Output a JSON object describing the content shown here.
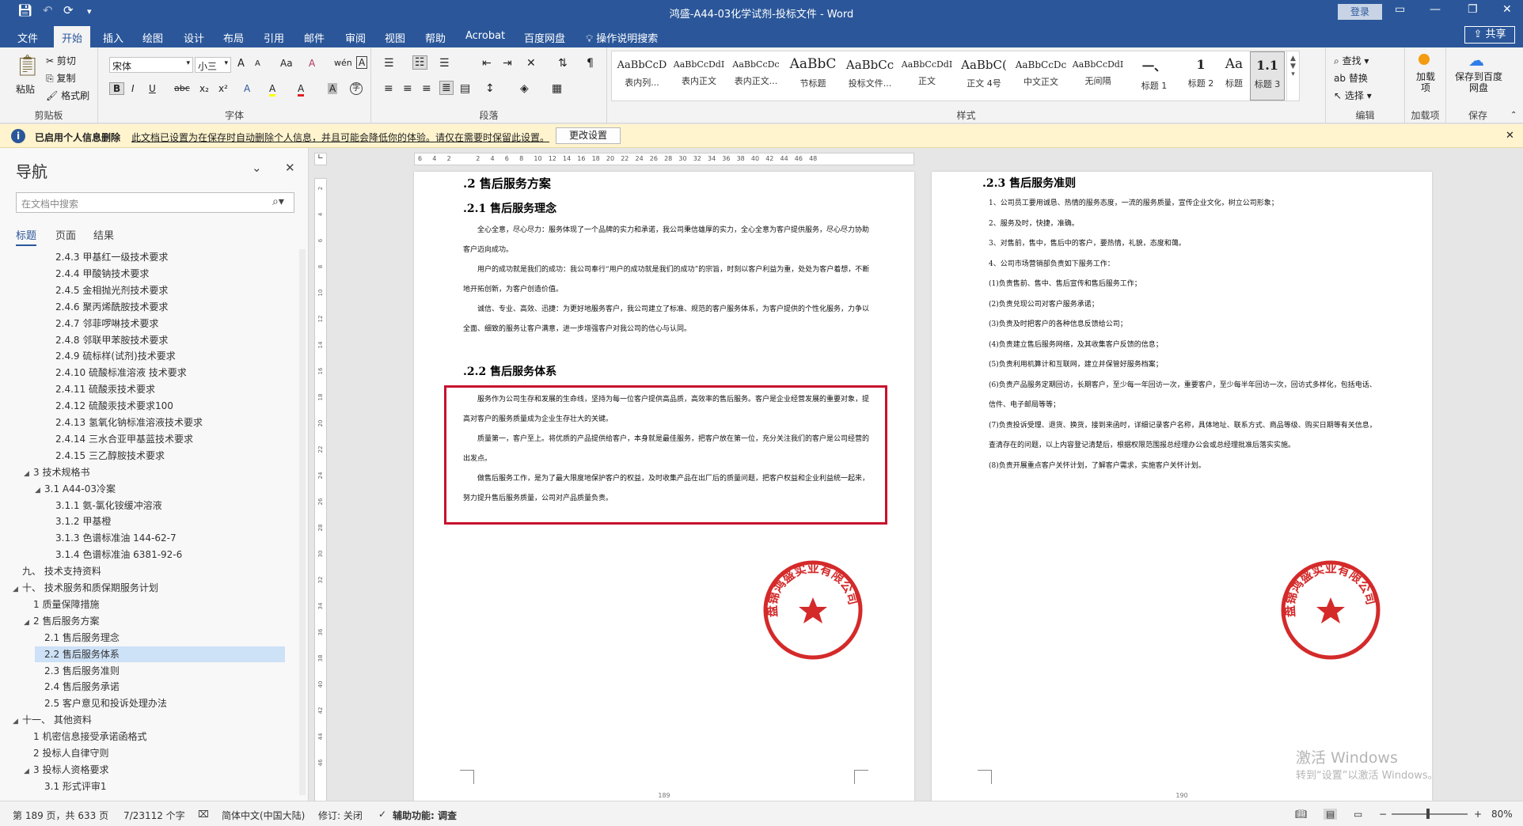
{
  "titlebar": {
    "doc_title": "鸿盛-A44-03化学试剂-投标文件 - Word",
    "login": "登录",
    "save_icon": "save-icon",
    "undo_icon": "undo-icon",
    "redo_icon": "redo-icon",
    "customize_icon": "customize-icon"
  },
  "menu": {
    "tabs": [
      "文件",
      "开始",
      "插入",
      "绘图",
      "设计",
      "布局",
      "引用",
      "邮件",
      "审阅",
      "视图",
      "帮助",
      "Acrobat",
      "百度网盘"
    ],
    "active": "开始",
    "tell_me": "操作说明搜索",
    "share": "共享"
  },
  "ribbon": {
    "clipboard": {
      "paste": "粘贴",
      "cut": "剪切",
      "copy": "复制",
      "format_painter": "格式刷",
      "label": "剪贴板"
    },
    "font": {
      "family": "宋体",
      "size": "小三",
      "label": "字体",
      "bold": "B",
      "italic": "I",
      "underline": "U",
      "strike": "abc",
      "subscript": "x₂",
      "superscript": "x²",
      "grow": "A",
      "shrink": "A",
      "case": "Aa",
      "clear": "A",
      "phonetic": "wén",
      "border_char": "A",
      "highlight": "A",
      "font_color": "A",
      "shading": "A",
      "enclose": "字"
    },
    "paragraph": {
      "label": "段落"
    },
    "styles": {
      "label": "样式",
      "items": [
        {
          "sample": "AaBbCcD",
          "name": "表内列..."
        },
        {
          "sample": "AaBbCcDdI",
          "name": "表内正文"
        },
        {
          "sample": "AaBbCcDc",
          "name": "表内正文..."
        },
        {
          "sample": "AaBbC",
          "name": "节标题"
        },
        {
          "sample": "AaBbCc",
          "name": "投标文件..."
        },
        {
          "sample": "AaBbCcDdI",
          "name": "正文"
        },
        {
          "sample": "AaBbC(",
          "name": "正文 4号"
        },
        {
          "sample": "AaBbCcDc",
          "name": "中文正文"
        },
        {
          "sample": "AaBbCcDdI",
          "name": "无间隔"
        },
        {
          "sample": "一、",
          "name": "标题 1"
        },
        {
          "sample": "1",
          "name": "标题 2"
        },
        {
          "sample": "Aa",
          "name": "标题"
        },
        {
          "sample": "1.1",
          "name": "标题 3"
        }
      ]
    },
    "editing": {
      "find": "查找",
      "replace": "替换",
      "select": "选择",
      "label": "编辑"
    },
    "addins": {
      "add": "加载项",
      "label": "加载项"
    },
    "save": {
      "save_to_baidu": "保存到百度网盘",
      "label": "保存"
    }
  },
  "infobar": {
    "title": "已启用个人信息删除",
    "message": "此文档已设置为在保存时自动删除个人信息，并且可能会降低你的体验。请仅在需要时保留此设置。",
    "button": "更改设置"
  },
  "nav": {
    "title": "导航",
    "search_placeholder": "在文档中搜索",
    "tabs": [
      "标题",
      "页面",
      "结果"
    ],
    "active_tab": "标题",
    "items": [
      {
        "label": "2.4.3 甲基红一级技术要求",
        "level": 4,
        "toggle": ""
      },
      {
        "label": "2.4.4 甲酸钠技术要求",
        "level": 4,
        "toggle": ""
      },
      {
        "label": "2.4.5 金相抛光剂技术要求",
        "level": 4,
        "toggle": ""
      },
      {
        "label": "2.4.6 聚丙烯酰胺技术要求",
        "level": 4,
        "toggle": ""
      },
      {
        "label": "2.4.7 邻菲啰啉技术要求",
        "level": 4,
        "toggle": ""
      },
      {
        "label": "2.4.8 邻联甲苯胺技术要求",
        "level": 4,
        "toggle": ""
      },
      {
        "label": "2.4.9 硫标样(试剂)技术要求",
        "level": 4,
        "toggle": ""
      },
      {
        "label": "2.4.10 硫酸标准溶液 技术要求",
        "level": 4,
        "toggle": ""
      },
      {
        "label": "2.4.11 硫酸汞技术要求",
        "level": 4,
        "toggle": ""
      },
      {
        "label": "2.4.12 硫酸汞技术要求100",
        "level": 4,
        "toggle": ""
      },
      {
        "label": "2.4.13 氢氧化钠标准溶液技术要求",
        "level": 4,
        "toggle": ""
      },
      {
        "label": "2.4.14 三水合亚甲基蓝技术要求",
        "level": 4,
        "toggle": ""
      },
      {
        "label": "2.4.15 三乙醇胺技术要求",
        "level": 4,
        "toggle": ""
      },
      {
        "label": "3 技术规格书",
        "level": 2,
        "toggle": "◢"
      },
      {
        "label": "3.1 A44-03冷案",
        "level": 3,
        "toggle": "◢"
      },
      {
        "label": "3.1.1 氨-氯化铵缓冲溶液",
        "level": 4,
        "toggle": ""
      },
      {
        "label": "3.1.2 甲基橙",
        "level": 4,
        "toggle": ""
      },
      {
        "label": "3.1.3 色谱标准油 144-62-7",
        "level": 4,
        "toggle": ""
      },
      {
        "label": "3.1.4 色谱标准油 6381-92-6",
        "level": 4,
        "toggle": ""
      },
      {
        "label": "九、 技术支持资料",
        "level": 1,
        "toggle": ""
      },
      {
        "label": "十、 技术服务和质保期服务计划",
        "level": 1,
        "toggle": "◢"
      },
      {
        "label": "1 质量保障措施",
        "level": 2,
        "toggle": ""
      },
      {
        "label": "2 售后服务方案",
        "level": 2,
        "toggle": "◢"
      },
      {
        "label": "2.1 售后服务理念",
        "level": 3,
        "toggle": ""
      },
      {
        "label": "2.2 售后服务体系",
        "level": 3,
        "toggle": "",
        "selected": true
      },
      {
        "label": "2.3 售后服务准则",
        "level": 3,
        "toggle": ""
      },
      {
        "label": "2.4 售后服务承诺",
        "level": 3,
        "toggle": ""
      },
      {
        "label": "2.5 客户意见和投诉处理办法",
        "level": 3,
        "toggle": ""
      },
      {
        "label": "十一、 其他资料",
        "level": 1,
        "toggle": "◢"
      },
      {
        "label": "1 机密信息接受承诺函格式",
        "level": 2,
        "toggle": ""
      },
      {
        "label": "2 投标人自律守则",
        "level": 2,
        "toggle": ""
      },
      {
        "label": "3 投标人资格要求",
        "level": 2,
        "toggle": "◢"
      },
      {
        "label": "3.1 形式评审1",
        "level": 3,
        "toggle": ""
      }
    ]
  },
  "ruler": {
    "h_ticks": [
      "6",
      "4",
      "2",
      "",
      "2",
      "4",
      "6",
      "8",
      "10",
      "12",
      "14",
      "16",
      "18",
      "20",
      "22",
      "24",
      "26",
      "28",
      "30",
      "32",
      "34",
      "36",
      "38",
      "40",
      "42",
      "44",
      "46",
      "48"
    ],
    "v_ticks": [
      "2",
      "4",
      "6",
      "8",
      "10",
      "12",
      "14",
      "16",
      "18",
      "20",
      "22",
      "24",
      "26",
      "28",
      "30",
      "32",
      "34",
      "36",
      "38",
      "40",
      "42",
      "44",
      "46"
    ]
  },
  "page1": {
    "h_2": ".2  售后服务方案",
    "h_21": ".2.1   售后服务理念",
    "p1": [
      "全心全意，尽心尽力：服务体现了一个品牌的实力和承诺，我公司秉信雄厚的实力，全心全意为客户提供服务，尽心尽力协助客户迈向成功。",
      "用户的成功就是我们的成功：我公司奉行“用户的成功就是我们的成功”的宗旨，时刻以客户利益为重，处处为客户着想，不断地开拓创新，为客户创造价值。",
      "诚信、专业、高效、迅捷：为更好地服务客户，我公司建立了标准、规范的客户服务体系，为客户提供的个性化服务，力争以全面、细致的服务让客户满意，进一步增强客户对我公司的信心与认同。"
    ],
    "h_22": ".2.2   售后服务体系",
    "p2": [
      "服务作为公司生存和发展的生命线，坚持为每一位客户提供高品质，高效率的售后服务。客户是企业经营发展的重要对象，提高对客户的服务质量成为企业生存壮大的关键。",
      "质量第一，客户至上。将优质的产品提供给客户，本身就是最佳服务，把客户放在第一位，充分关注我们的客户是公司经营的出发点。",
      "做售后服务工作，是为了最大限度地保护客户的权益，及时收集产品在出厂后的质量问题，把客户权益和企业利益统一起来，努力提升售后服务质量，公司对产品质量负责。"
    ],
    "page_number": "189"
  },
  "page2": {
    "h_23": ".2.3   售后服务准则",
    "items": [
      "1、公司员工要用诚恳、热情的服务态度，一流的服务质量，宣传企业文化，树立公司形象；",
      "2、服务及时，快捷，准确。",
      "3、对售前，售中，售后中的客户，要热情，礼貌，态度和蔼。",
      "4、公司市场营销部负责如下服务工作：",
      "(1)负责售前、售中、售后宣传和售后服务工作；",
      "(2)负责兑现公司对客户服务承诺；",
      "(3)负责及时把客户的各种信息反馈给公司；",
      "(4)负责建立售后服务网络，及其收集客户反馈的信息；",
      "(5)负责利用机算计和互联网，建立并保管好服务档案；",
      "(6)负责产品服务定期回访，长期客户，至少每一年回访一次，重要客户，至少每半年回访一次，回访式多样化，包括电话、信件、电子邮局等等；",
      "(7)负责投诉受理、退货、换货，接到来函时，详细记录客户名称，具体地址、联系方式、商品等级、购买日期等有关信息，查清存在的问题，以上内容登记清楚后，根据权限范围报总经理办公会或总经理批准后落实实施。",
      "(8)负责开展重点客户关怀计划，了解客户需求，实施客户关怀计划。"
    ],
    "page_number": "190"
  },
  "seal": {
    "text": "盘锦鸿盛实业有限公司",
    "color": "#d42a2a"
  },
  "watermark": {
    "line1": "激活 Windows",
    "line2": "转到“设置”以激活 Windows。"
  },
  "status": {
    "page": "第 189 页，共 633 页",
    "words": "7/23112 个字",
    "language": "简体中文(中国大陆)",
    "track": "修订: 关闭",
    "accessibility": "辅助功能: 调查",
    "zoom": "80%"
  }
}
